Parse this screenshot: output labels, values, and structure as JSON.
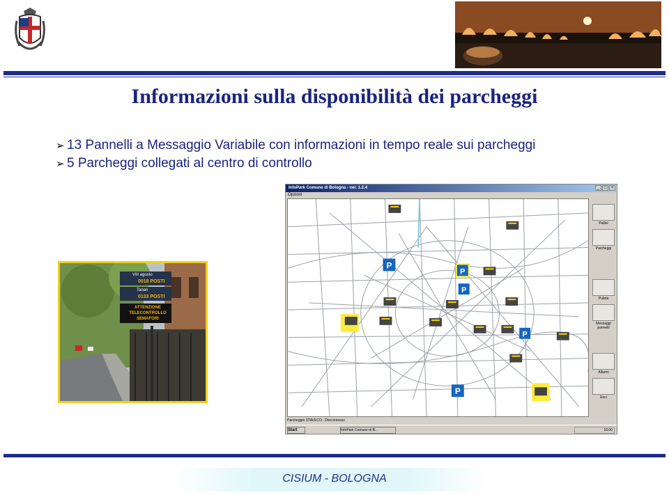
{
  "header": {
    "title": "Informazioni sulla disponibilità dei parcheggi"
  },
  "bullets": [
    "13 Pannelli a Messaggio Variabile con informazioni in tempo reale sui parcheggi",
    "5 Parcheggi collegati al centro di controllo"
  ],
  "panel_sign": {
    "line1": "VIII agosto",
    "line2": "0018 POSTI",
    "line3": "Tanari",
    "line4": "0133 POSTI",
    "line5": "ATTENZIONE",
    "line6": "TELECONTROLLO",
    "line7": "SEMAFORI"
  },
  "app": {
    "title": "InfoPark Comune di Bologna - ver. 1.2.4",
    "menu": "Opzioni",
    "tools": [
      "Pallini",
      "Parcheggi",
      "Pulizia",
      "Messaggi pannelli",
      "Allarmi",
      "Esci"
    ],
    "status": "Parcheggio STAVECO - Disconnesso",
    "start": "Start",
    "task": "InfoPark Comune di B...",
    "clock": "16:00"
  },
  "footer": {
    "text": "CISIUM - BOLOGNA"
  },
  "colors": {
    "title": "#1a237e",
    "rule": "#1d2b8c",
    "photo_frame": "#f0d01a"
  }
}
